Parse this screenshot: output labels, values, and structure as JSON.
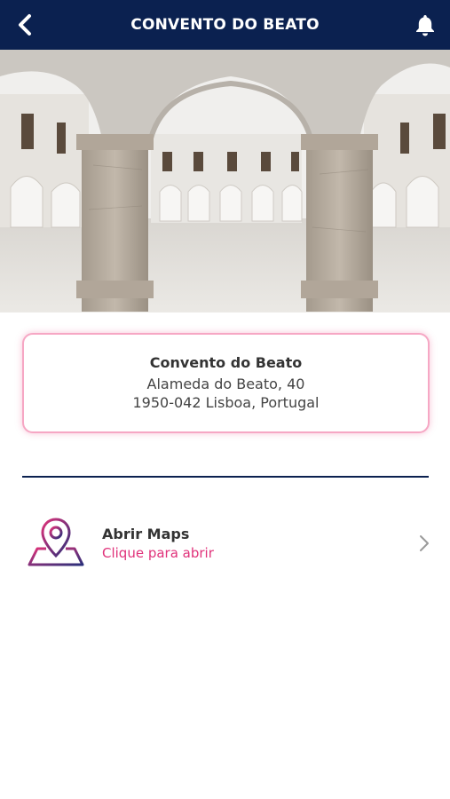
{
  "header": {
    "title": "CONVENTO DO BEATO",
    "back_icon": "chevron-left-icon",
    "notification_icon": "bell-icon"
  },
  "hero": {
    "image": "cloister-arches-photo"
  },
  "venue": {
    "name": "Convento do Beato",
    "address_line1": "Alameda do Beato, 40",
    "address_line2": "1950-042 Lisboa, Portugal"
  },
  "maps": {
    "label": "Abrir Maps",
    "sublabel": "Clique para abrir",
    "icon": "map-pin-icon",
    "chevron_icon": "chevron-right-icon"
  },
  "colors": {
    "header_bg": "#0b2150",
    "accent_pink": "#e0327a",
    "card_border": "#f6a7c4"
  }
}
